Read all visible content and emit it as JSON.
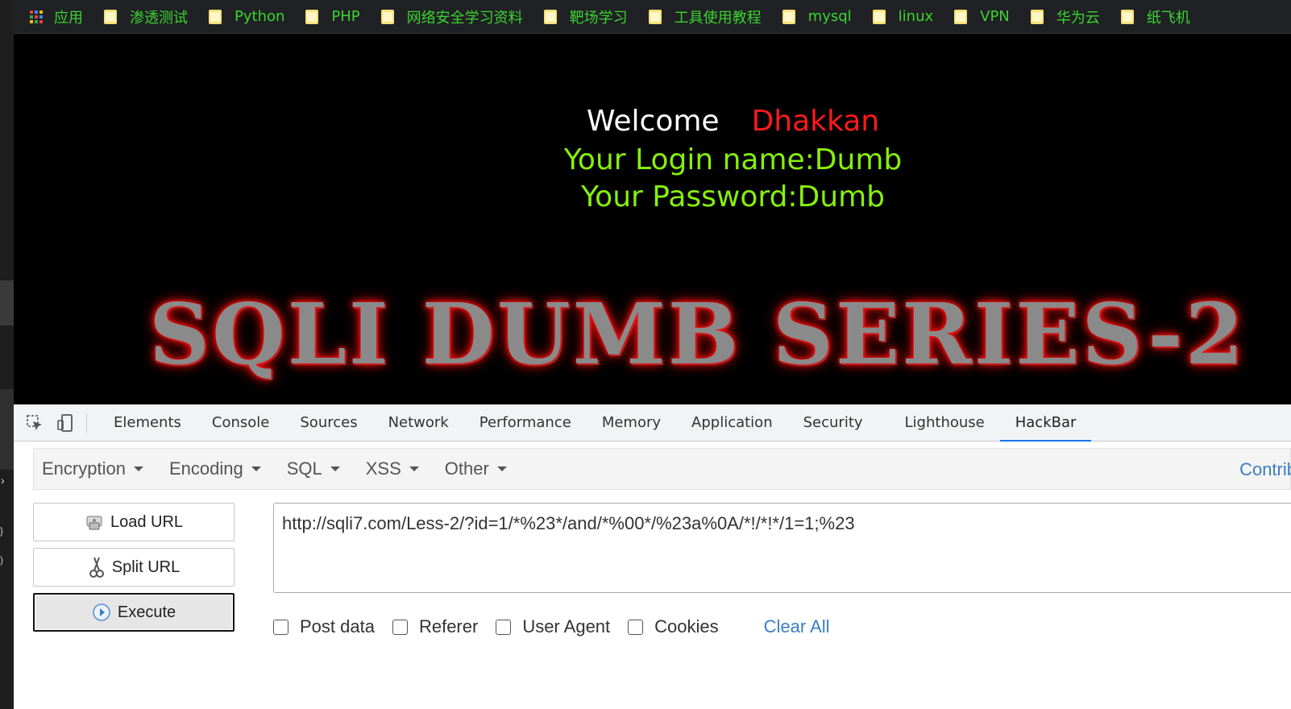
{
  "bookmarks": [
    {
      "label": "应用",
      "icon": "apps-grid-icon"
    },
    {
      "label": "渗透测试",
      "icon": "folder-icon"
    },
    {
      "label": "Python",
      "icon": "folder-icon"
    },
    {
      "label": "PHP",
      "icon": "folder-icon"
    },
    {
      "label": "网络安全学习资料",
      "icon": "folder-icon"
    },
    {
      "label": "靶场学习",
      "icon": "folder-icon"
    },
    {
      "label": "工具使用教程",
      "icon": "folder-icon"
    },
    {
      "label": "mysql",
      "icon": "folder-icon"
    },
    {
      "label": "linux",
      "icon": "folder-icon"
    },
    {
      "label": "VPN",
      "icon": "folder-icon"
    },
    {
      "label": "华为云",
      "icon": "folder-icon"
    },
    {
      "label": "纸飞机",
      "icon": "folder-icon"
    }
  ],
  "page": {
    "welcome": "Welcome",
    "user_name": "Dhakkan",
    "login_line": "Your Login name:Dumb",
    "password_line": "Your Password:Dumb",
    "banner": "SQLI DUMB SERIES-2"
  },
  "devtools": {
    "tabs": [
      "Elements",
      "Console",
      "Sources",
      "Network",
      "Performance",
      "Memory",
      "Application",
      "Security",
      "Lighthouse",
      "HackBar"
    ],
    "active_tab": "HackBar"
  },
  "hackbar": {
    "menu": [
      "Encryption",
      "Encoding",
      "SQL",
      "XSS",
      "Other"
    ],
    "contrib": "Contrib",
    "load_url": "Load URL",
    "split_url": "Split URL",
    "execute": "Execute",
    "url_value": "http://sqli7.com/Less-2/?id=1/*%23*/and/*%00*/%23a%0A/*!/*!*/1=1;%23",
    "options": [
      "Post data",
      "Referer",
      "User Agent",
      "Cookies"
    ],
    "clear_all": "Clear All"
  },
  "colors": {
    "bookmark_text": "#39d42f",
    "welcome": "#ffffff",
    "user_name": "#ff1a1a",
    "login_text": "#86f00a",
    "link_blue": "#3b7dc4",
    "active_tab_underline": "#1a73e8"
  }
}
